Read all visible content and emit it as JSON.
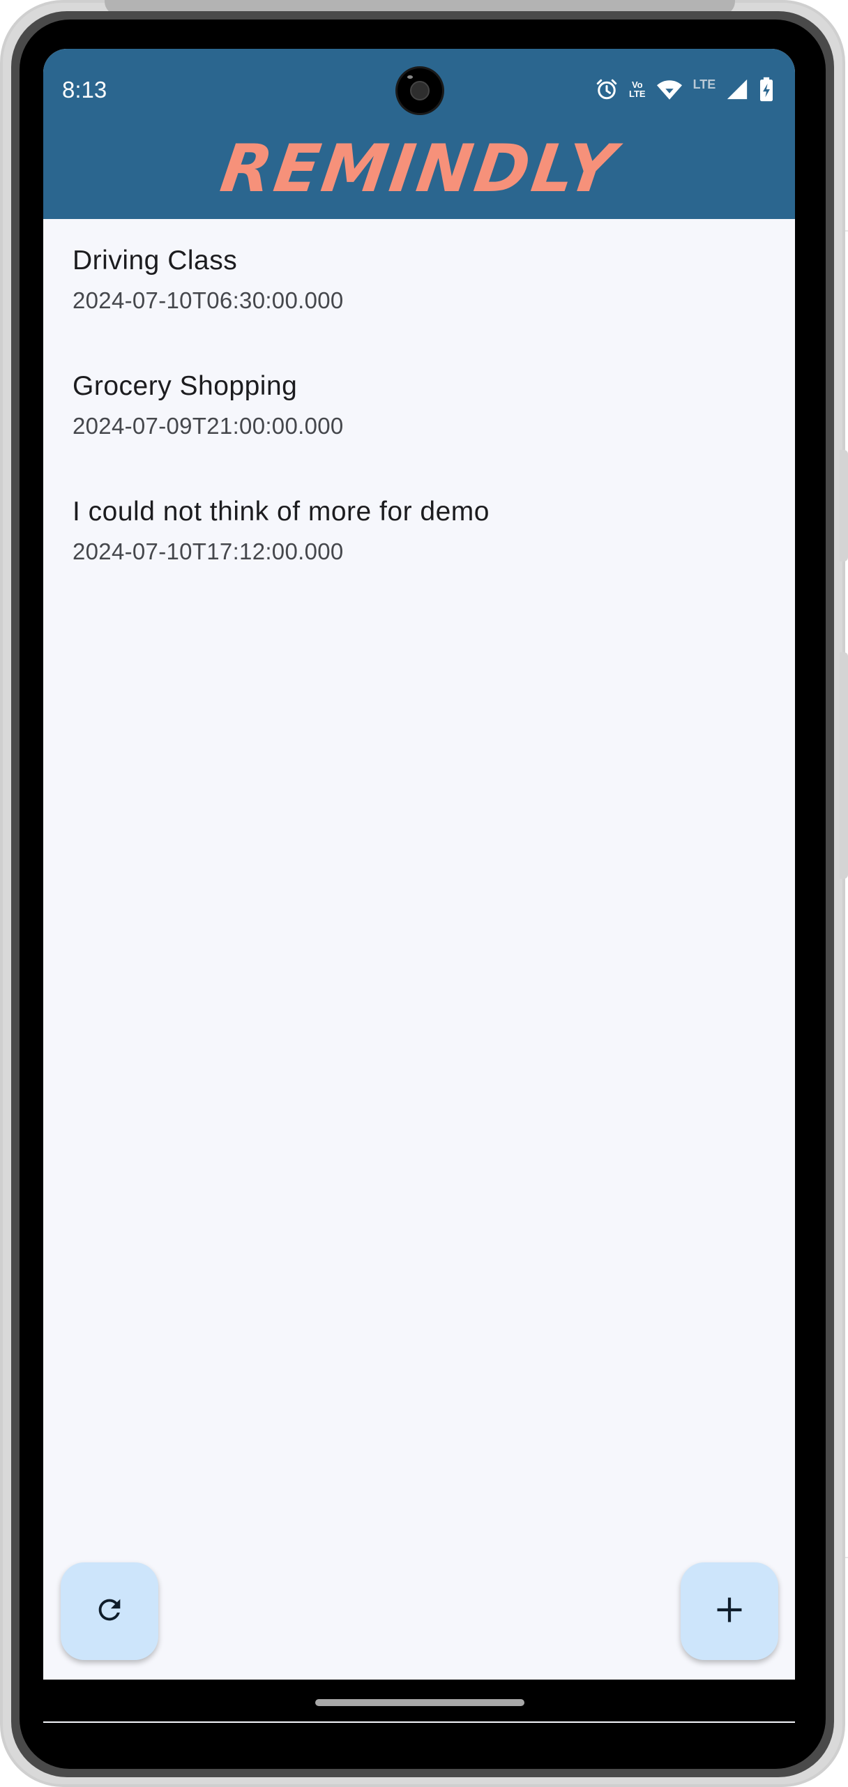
{
  "status_bar": {
    "time": "8:13",
    "icons": [
      "alarm-icon",
      "volte-icon",
      "wifi-icon",
      "lte-icon",
      "cell-signal-icon",
      "battery-charging-icon"
    ],
    "volte_line1": "Vo",
    "volte_line2": "LTE",
    "lte_label": "LTE"
  },
  "app_bar": {
    "title": "REMINDLY",
    "background_color": "#2b668f",
    "title_color": "#f6917a"
  },
  "reminders": [
    {
      "title": "Driving Class",
      "datetime": "2024-07-10T06:30:00.000"
    },
    {
      "title": "Grocery Shopping",
      "datetime": "2024-07-09T21:00:00.000"
    },
    {
      "title": "I could not think of more for demo",
      "datetime": "2024-07-10T17:12:00.000"
    }
  ],
  "fabs": {
    "refresh_icon": "refresh-icon",
    "add_icon": "plus-icon",
    "color": "#cde5fb"
  },
  "screen_background": "#f6f7fc"
}
